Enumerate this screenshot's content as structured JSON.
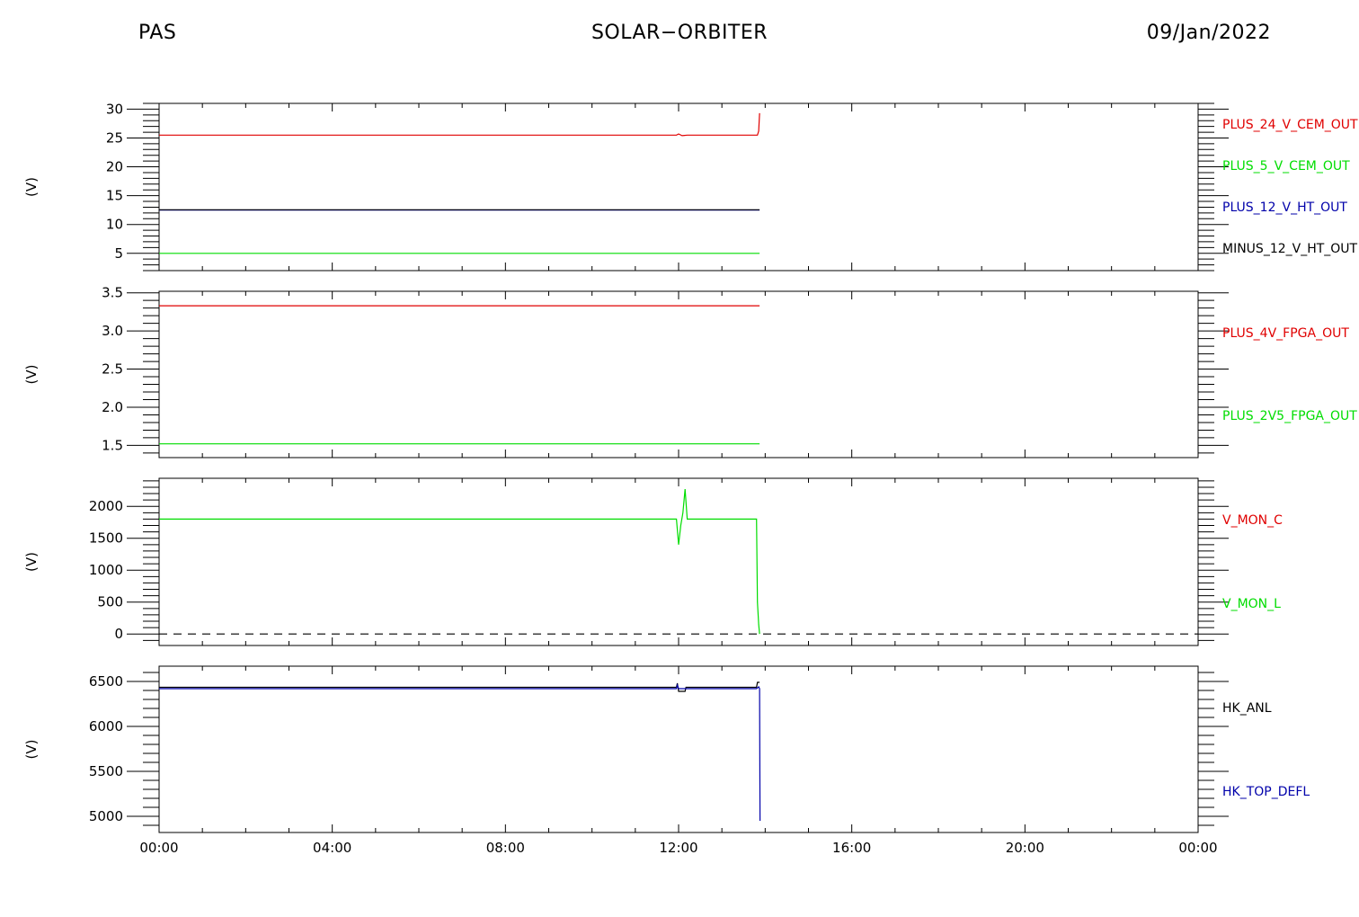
{
  "header": {
    "left": "PAS",
    "center": "SOLAR−ORBITER",
    "right": "09/Jan/2022"
  },
  "chart_data": [
    {
      "type": "line",
      "ylabel": "(V)",
      "ylim": [
        2,
        31
      ],
      "yticks": [
        5,
        10,
        15,
        20,
        25,
        30
      ],
      "ytick_labels": [
        "5",
        "10",
        "15",
        "20",
        "25",
        "30"
      ],
      "xlim": [
        0,
        24
      ],
      "series": [
        {
          "name": "PLUS_24_V_CEM_OUT",
          "color": "#e00000",
          "points": [
            [
              0,
              25.5
            ],
            [
              11.95,
              25.5
            ],
            [
              12.0,
              25.7
            ],
            [
              12.08,
              25.4
            ],
            [
              12.2,
              25.5
            ],
            [
              13.82,
              25.5
            ],
            [
              13.85,
              26.2
            ],
            [
              13.87,
              29.3
            ]
          ]
        },
        {
          "name": "PLUS_5_V_CEM_OUT",
          "color": "#00dd00",
          "points": [
            [
              0,
              5.0
            ],
            [
              13.87,
              5.0
            ]
          ]
        },
        {
          "name": "PLUS_12_V_HT_OUT",
          "color": "#0000aa",
          "points": [
            [
              0,
              12.5
            ],
            [
              13.87,
              12.5
            ]
          ]
        },
        {
          "name": "MINUS_12_V_HT_OUT",
          "color": "#000000",
          "points": [
            [
              0,
              12.55
            ],
            [
              13.87,
              12.55
            ]
          ]
        }
      ]
    },
    {
      "type": "line",
      "ylabel": "(V)",
      "ylim": [
        1.34,
        3.52
      ],
      "yticks": [
        1.5,
        2.0,
        2.5,
        3.0,
        3.5
      ],
      "ytick_labels": [
        "1.5",
        "2.0",
        "2.5",
        "3.0",
        "3.5"
      ],
      "xlim": [
        0,
        24
      ],
      "series": [
        {
          "name": "PLUS_4V_FPGA_OUT",
          "color": "#e00000",
          "points": [
            [
              0,
              3.33
            ],
            [
              13.87,
              3.33
            ]
          ]
        },
        {
          "name": "PLUS_2V5_FPGA_OUT",
          "color": "#00dd00",
          "points": [
            [
              0,
              1.52
            ],
            [
              13.87,
              1.52
            ]
          ]
        }
      ]
    },
    {
      "type": "line",
      "ylabel": "(V)",
      "ylim": [
        -180,
        2440
      ],
      "yticks": [
        0,
        500,
        1000,
        1500,
        2000
      ],
      "ytick_labels": [
        "0",
        "500",
        "1000",
        "1500",
        "2000"
      ],
      "xlim": [
        0,
        24
      ],
      "series": [
        {
          "name": "V_MON_C",
          "color": "#e00000",
          "dashed": true,
          "points": [
            [
              0,
              0
            ],
            [
              24,
              0
            ]
          ]
        },
        {
          "name": "V_MON_L",
          "color": "#00dd00",
          "points": [
            [
              0,
              1800
            ],
            [
              11.95,
              1800
            ],
            [
              12.0,
              1400
            ],
            [
              12.05,
              1700
            ],
            [
              12.1,
              1900
            ],
            [
              12.15,
              2270
            ],
            [
              12.2,
              1800
            ],
            [
              13.8,
              1800
            ],
            [
              13.82,
              500
            ],
            [
              13.85,
              150
            ],
            [
              13.87,
              0
            ]
          ]
        }
      ]
    },
    {
      "type": "line",
      "ylabel": "(V)",
      "ylim": [
        4820,
        6670
      ],
      "yticks": [
        5000,
        5500,
        6000,
        6500
      ],
      "ytick_labels": [
        "5000",
        "5500",
        "6000",
        "6500"
      ],
      "xlim": [
        0,
        24
      ],
      "series": [
        {
          "name": "HK_ANL",
          "color": "#000000",
          "points": [
            [
              0,
              6435
            ],
            [
              11.95,
              6435
            ],
            [
              11.97,
              6480
            ],
            [
              12.0,
              6390
            ],
            [
              12.15,
              6390
            ],
            [
              12.17,
              6435
            ],
            [
              13.8,
              6435
            ],
            [
              13.82,
              6490
            ],
            [
              13.87,
              6490
            ]
          ]
        },
        {
          "name": "HK_TOP_DEFL",
          "color": "#0000aa",
          "points": [
            [
              0,
              6420
            ],
            [
              11.95,
              6420
            ],
            [
              11.97,
              6460
            ],
            [
              12.0,
              6420
            ],
            [
              13.8,
              6420
            ],
            [
              13.85,
              6440
            ],
            [
              13.87,
              6420
            ],
            [
              13.88,
              4950
            ]
          ]
        }
      ]
    }
  ],
  "xaxis": {
    "ticks": [
      0,
      4,
      8,
      12,
      16,
      20,
      24
    ],
    "tick_labels": [
      "00:00",
      "04:00",
      "08:00",
      "12:00",
      "16:00",
      "20:00",
      "00:00"
    ]
  }
}
